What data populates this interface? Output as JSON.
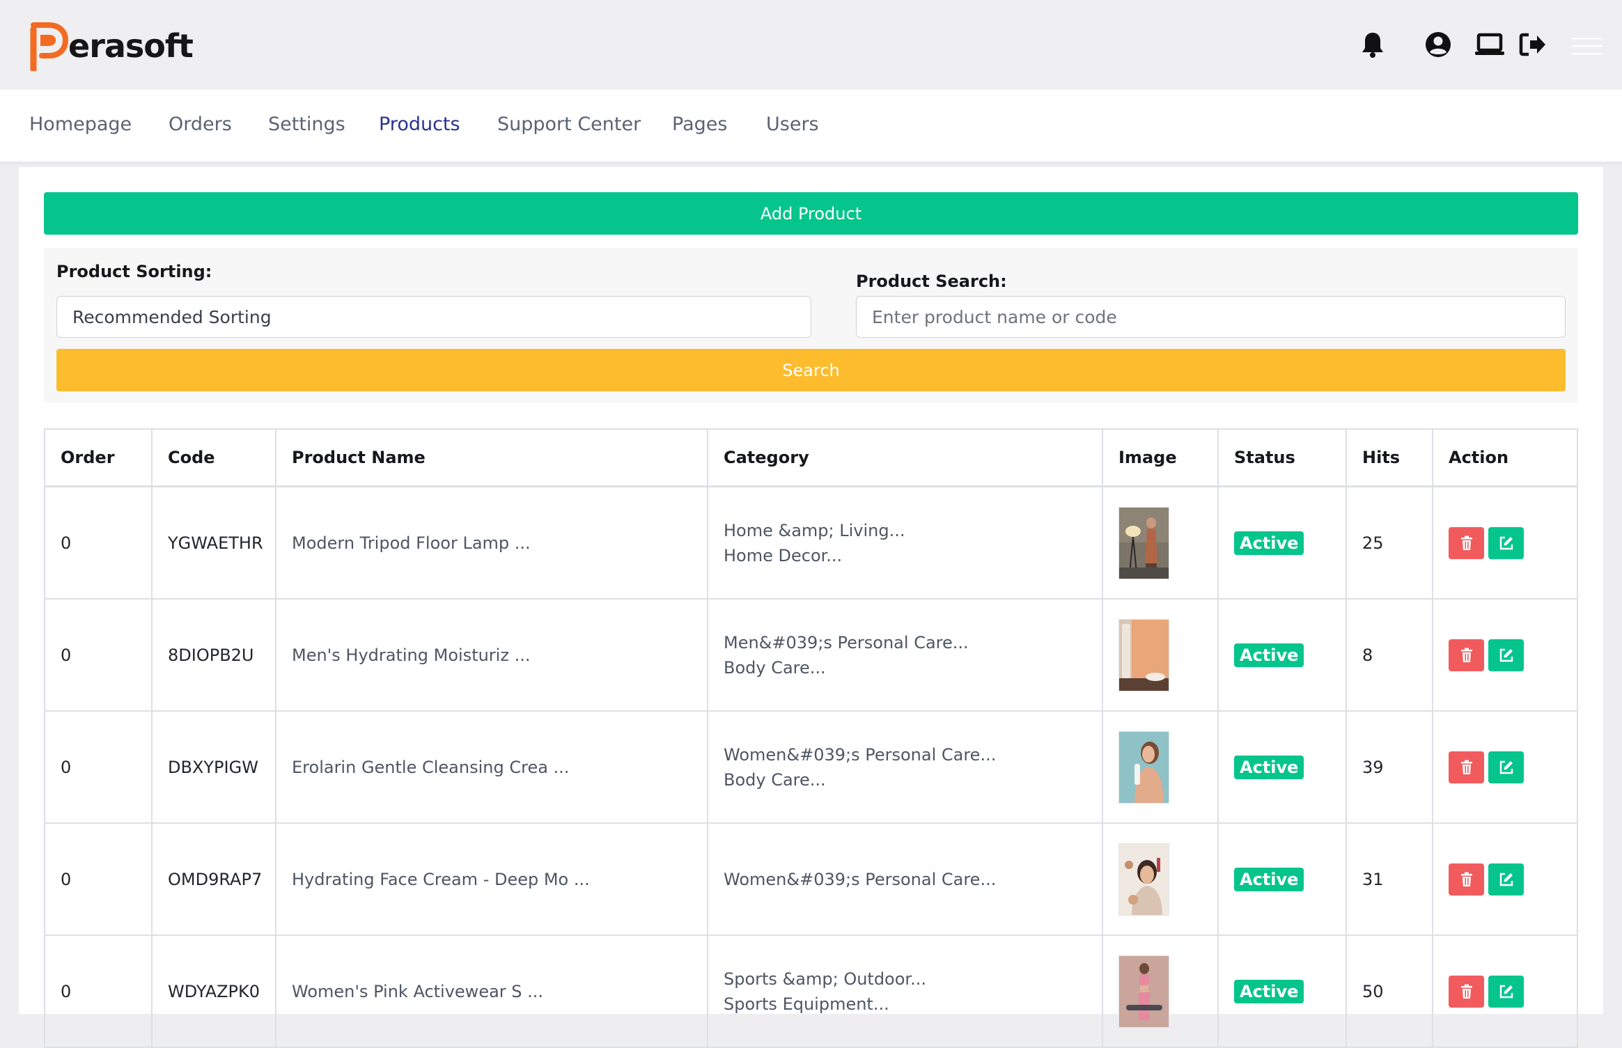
{
  "brand": {
    "logo_text": "erasoft",
    "accent": "#f26b21",
    "icons": [
      "bell-icon",
      "user-circle-icon",
      "laptop-icon",
      "logout-icon",
      "hamburger-menu-icon"
    ]
  },
  "nav": {
    "items": [
      {
        "label": "Homepage"
      },
      {
        "label": "Orders"
      },
      {
        "label": "Settings"
      },
      {
        "label": "Products"
      },
      {
        "label": "Support Center"
      },
      {
        "label": "Pages"
      },
      {
        "label": "Users"
      }
    ],
    "active": "Products"
  },
  "actions": {
    "add_product": "Add Product",
    "search": "Search"
  },
  "filters": {
    "sorting_label": "Product Sorting:",
    "sorting_value": "Recommended Sorting",
    "search_label": "Product Search:",
    "search_placeholder": "Enter product name or code"
  },
  "table": {
    "headers": {
      "order": "Order",
      "code": "Code",
      "name": "Product Name",
      "category": "Category",
      "image": "Image",
      "status": "Status",
      "hits": "Hits",
      "action": "Action"
    },
    "rows": [
      {
        "order": "0",
        "code": "YGWAETHR",
        "name": "Modern Tripod Floor Lamp ...",
        "cat1": "Home &amp; Living...",
        "cat2": "Home Decor...",
        "status": "Active",
        "hits": "25"
      },
      {
        "order": "0",
        "code": "8DIOPB2U",
        "name": "Men's Hydrating Moisturiz ...",
        "cat1": "Men&#039;s Personal Care...",
        "cat2": "Body Care...",
        "status": "Active",
        "hits": "8"
      },
      {
        "order": "0",
        "code": "DBXYPIGW",
        "name": "Erolarin Gentle Cleansing Crea ...",
        "cat1": "Women&#039;s Personal Care...",
        "cat2": "Body Care...",
        "status": "Active",
        "hits": "39"
      },
      {
        "order": "0",
        "code": "OMD9RAP7",
        "name": "Hydrating Face Cream - Deep Mo ...",
        "cat1": "Women&#039;s Personal Care...",
        "cat2": "",
        "status": "Active",
        "hits": "31"
      },
      {
        "order": "0",
        "code": "WDYAZPK0",
        "name": "Women's Pink Activewear S ...",
        "cat1": "Sports &amp; Outdoor...",
        "cat2": "Sports Equipment...",
        "status": "Active",
        "hits": "50"
      }
    ]
  }
}
